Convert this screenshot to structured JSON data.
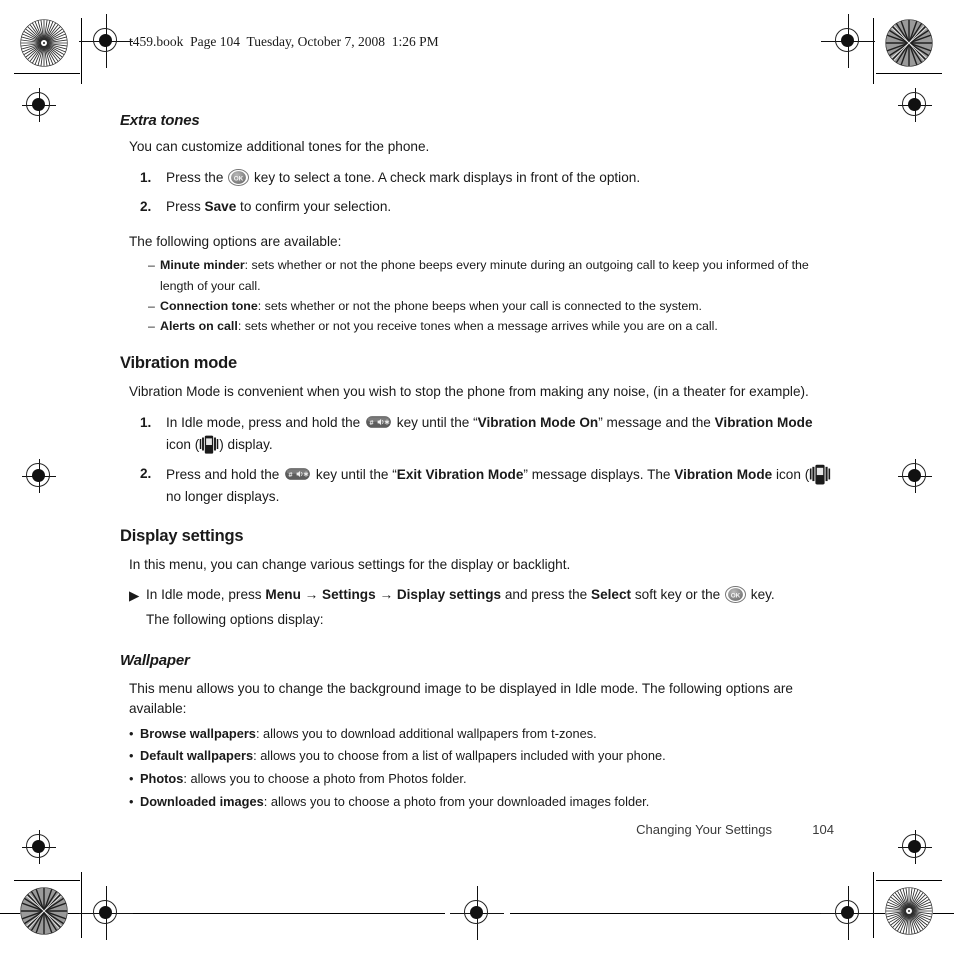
{
  "page": {
    "book_header": "t459.book  Page 104  Tuesday, October 7, 2008  1:26 PM",
    "footer_chapter": "Changing Your Settings",
    "footer_page_number": "104"
  },
  "sections": [
    {
      "id": "extra-tones",
      "heading": "Extra tones",
      "heading_style": "italic-sub",
      "intro": "You can customize additional tones for the phone.",
      "steps": [
        {
          "num": "1.",
          "pre": "Press the ",
          "icon": "ok-key-icon",
          "post_a": " key to select a tone. A check mark displays in front of the option.",
          "bold_a": "",
          "post_b": ""
        },
        {
          "num": "2.",
          "pre": "Press ",
          "bold_a": "Save",
          "post_a": " to confirm your selection."
        }
      ],
      "options_lead": "The following options are available:",
      "dash_items": [
        {
          "term": "Minute minder",
          "desc": ": sets whether or not the phone beeps every minute during an outgoing call to keep you informed of the length of your call."
        },
        {
          "term": "Connection tone",
          "desc": ": sets whether or not the phone beeps when your call is connected to the system."
        },
        {
          "term": "Alerts on call",
          "desc": ": sets whether or not you receive tones when a message arrives while you are on a call."
        }
      ]
    },
    {
      "id": "vibration-mode",
      "heading": "Vibration mode",
      "heading_style": "section",
      "intro": "Vibration Mode is convenient when you wish to stop the phone from making any noise, (in a theater for example).",
      "step1": {
        "num": "1.",
        "p1": " In Idle mode, press and hold the ",
        "key_icon": "hash-key-icon",
        "p2": " key until the “",
        "b1": "Vibration Mode On",
        "p3": "” message and the ",
        "b2": "Vibration Mode",
        "p4": " icon (",
        "status_icon": "vibration-mode-status-icon",
        "p5": ") display."
      },
      "step2": {
        "num": "2.",
        "p1": "Press and hold the ",
        "key_icon": "hash-key-icon",
        "p2": " key until the “",
        "b1": "Exit Vibration Mode",
        "p3": "” message displays. The ",
        "b2": "Vibration Mode",
        "p4": " icon (",
        "status_icon": "vibration-mode-status-icon",
        "p5": " no longer displays."
      }
    },
    {
      "id": "display-settings",
      "heading": "Display settings",
      "heading_style": "section",
      "intro": "In this menu, you can change various settings for the display or backlight.",
      "nav": {
        "marker": "triangle-right-icon",
        "p1": "In Idle mode, press ",
        "b1": "Menu",
        "arrow1": "→",
        "b2": "Settings",
        "arrow2": "→",
        "b3": "Display settings",
        "p2": " and press the ",
        "b4": "Select",
        "p3": " soft key or the ",
        "key_icon": "ok-key-icon",
        "p4": " key."
      },
      "nav_sub": "The following options display:"
    },
    {
      "id": "wallpaper",
      "heading": "Wallpaper",
      "heading_style": "italic-sub",
      "intro": "This menu allows you to change the background image to be displayed in Idle mode. The following options are available:",
      "bullets": [
        {
          "term": "Browse wallpapers",
          "desc": ": allows you to download additional wallpapers from t-zones."
        },
        {
          "term": "Default wallpapers",
          "desc": ": allows you to choose from a list of wallpapers included with your phone."
        },
        {
          "term": "Photos",
          "desc": ": allows you to choose a photo from Photos folder."
        },
        {
          "term": "Downloaded images",
          "desc": ": allows you to choose a photo from your downloaded images folder."
        }
      ]
    }
  ],
  "colors": {
    "text": "#1a1a1a",
    "footer_text": "#3a3a3a",
    "page_background": "#ffffff",
    "mark_ink": "#111111"
  }
}
